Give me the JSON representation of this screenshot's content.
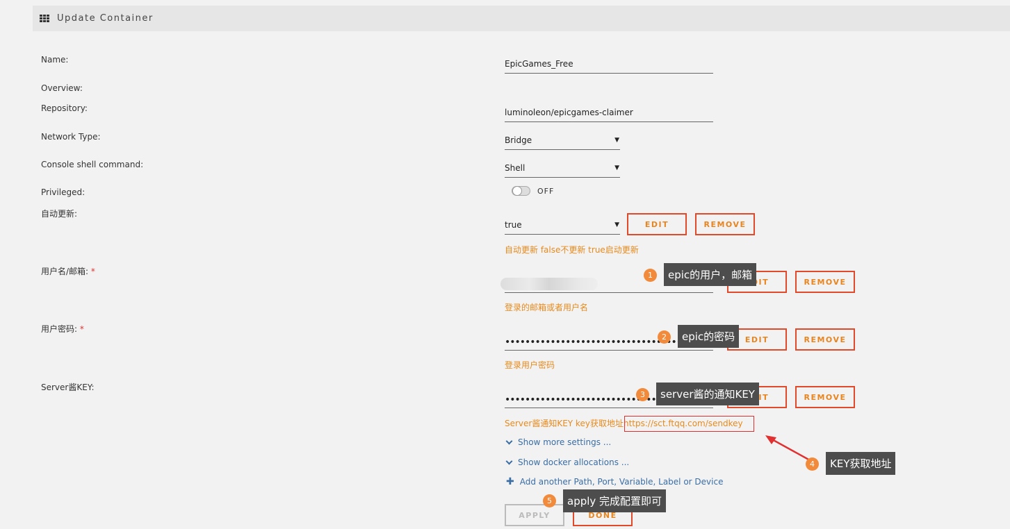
{
  "header": {
    "title": "Update Container",
    "icon": "grid-icon"
  },
  "labels": {
    "name": "Name:",
    "overview": "Overview:",
    "repository": "Repository:",
    "network_type": "Network Type:",
    "console_shell": "Console shell command:",
    "privileged": "Privileged:",
    "auto_update": "自动更新:",
    "username": "用户名/邮箱:",
    "password": "用户密码:",
    "server_key": "Server酱KEY:",
    "required_mark": "*"
  },
  "fields": {
    "name": "EpicGames_Free",
    "repository": "luminoleon/epicgames-claimer",
    "network_type": "Bridge",
    "console_shell": "Shell",
    "privileged_state": "OFF",
    "auto_update": "true",
    "password_mask": "••••••••••••••••••••••••••••••••••••••••••••",
    "server_key_mask": "•••••••••••••••••••••••••••••••••••"
  },
  "hints": {
    "auto_update": "自动更新 false不更新 true启动更新",
    "username": "登录的邮箱或者用户名",
    "password": "登录用户密码",
    "server_key_prefix": "Server酱通知KEY key获取地址",
    "server_key_url": "https://sct.ftqq.com/sendkey"
  },
  "buttons": {
    "edit": "EDIT",
    "remove": "REMOVE",
    "apply": "APPLY",
    "done": "DONE"
  },
  "links": {
    "more_settings": "Show more settings ...",
    "docker_allocations": "Show docker allocations ...",
    "add_another": "Add another Path, Port, Variable, Label or Device"
  },
  "annotations": [
    {
      "num": "1",
      "text": "epic的用户，邮箱"
    },
    {
      "num": "2",
      "text": "epic的密码"
    },
    {
      "num": "3",
      "text": "server酱的通知KEY"
    },
    {
      "num": "4",
      "text": "KEY获取地址"
    },
    {
      "num": "5",
      "text": "apply 完成配置即可"
    }
  ],
  "colors": {
    "accent_orange": "#e8851f",
    "button_border": "#e04a2a",
    "link_blue": "#3a6ea5",
    "badge": "#f28a3b",
    "callout_bg": "#4d4d4d",
    "highlight_red": "#e03030"
  }
}
